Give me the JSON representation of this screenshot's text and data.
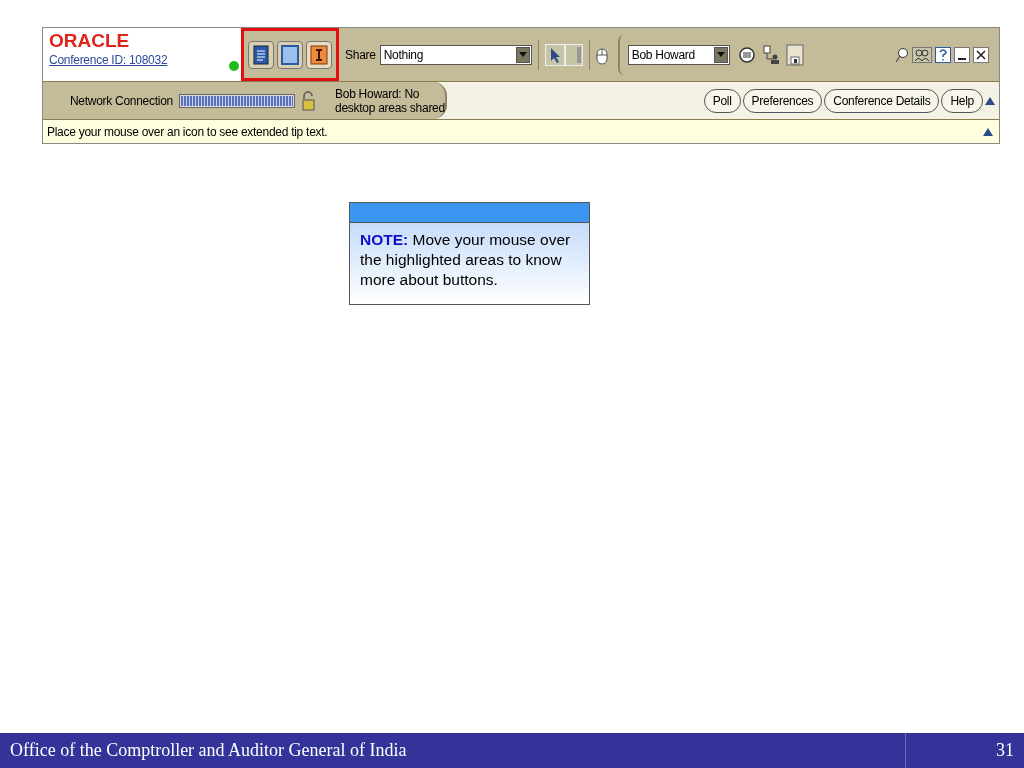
{
  "toolbar": {
    "logo": "ORACLE",
    "conference_id": "Conference ID: 108032",
    "connected": true,
    "mode_buttons_highlighted": true,
    "share_label": "Share",
    "share_value": "Nothing",
    "presenter_value": "Bob Howard",
    "network": {
      "label": "Network Connection",
      "level": 1
    },
    "sharing_status": "Bob Howard: No desktop areas shared",
    "buttons": [
      "Poll",
      "Preferences",
      "Conference Details",
      "Help"
    ],
    "tip": "Place your mouse over an icon to see extended tip text."
  },
  "note": {
    "text": "**NOTE:** Move your mouse over the highlighted areas to know more about buttons."
  },
  "footer": {
    "organization": "Office of the Comptroller and Auditor General of India",
    "page": "31"
  }
}
